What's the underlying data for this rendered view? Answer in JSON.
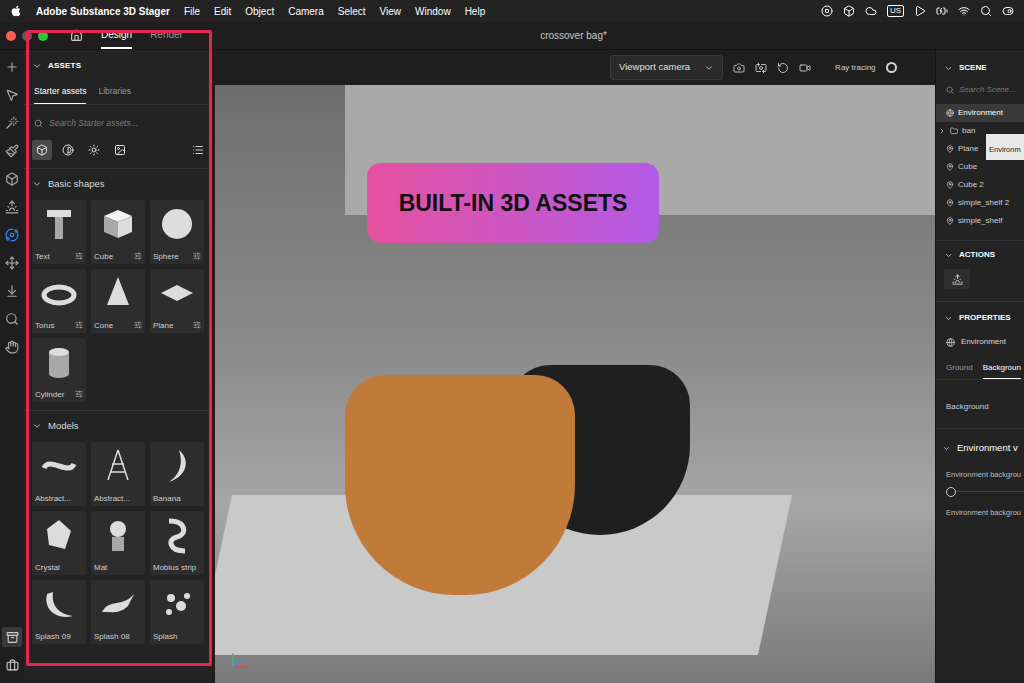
{
  "menubar": {
    "app": "Adobe Substance 3D Stager",
    "items": [
      "File",
      "Edit",
      "Object",
      "Camera",
      "Select",
      "View",
      "Window",
      "Help"
    ],
    "input_source": "US"
  },
  "titlebar": {
    "tabs": [
      {
        "label": "Design",
        "selected": true
      },
      {
        "label": "Render",
        "selected": false
      }
    ],
    "document": "crossover bag*"
  },
  "tools": [
    {
      "selected": false
    },
    {
      "selected": false
    },
    {
      "selected": false
    },
    {
      "selected": false
    },
    {
      "selected": false
    },
    {
      "selected": false
    },
    {
      "selected": true
    },
    {
      "selected": false
    },
    {
      "selected": false
    },
    {
      "selected": false
    },
    {
      "selected": false
    }
  ],
  "bottom_tools": [
    {
      "selected": true
    },
    {
      "selected": false
    }
  ],
  "assets": {
    "title": "ASSETS",
    "tabs": [
      {
        "label": "Starter assets",
        "selected": true
      },
      {
        "label": "Libraries",
        "selected": false
      }
    ],
    "search_placeholder": "Search Starter assets...",
    "filters": [
      {
        "selected": true
      },
      {
        "selected": false
      },
      {
        "selected": false
      },
      {
        "selected": false
      }
    ],
    "sections": [
      {
        "title": "Basic shapes",
        "expanded": true,
        "items": [
          {
            "label": "Text",
            "adjustable": true
          },
          {
            "label": "Cube",
            "adjustable": true
          },
          {
            "label": "Sphere",
            "adjustable": true
          },
          {
            "label": "Torus",
            "adjustable": true
          },
          {
            "label": "Cone",
            "adjustable": true
          },
          {
            "label": "Plane",
            "adjustable": true
          },
          {
            "label": "Cylinder",
            "adjustable": true
          }
        ]
      },
      {
        "title": "Models",
        "expanded": true,
        "items": [
          {
            "label": "Abstract...",
            "adjustable": false
          },
          {
            "label": "Abstract...",
            "adjustable": false
          },
          {
            "label": "Banana",
            "adjustable": false
          },
          {
            "label": "Crystal",
            "adjustable": false
          },
          {
            "label": "Mat",
            "adjustable": false
          },
          {
            "label": "Mobius strip",
            "adjustable": false
          },
          {
            "label": "Splash 09",
            "adjustable": false
          },
          {
            "label": "Splash 08",
            "adjustable": false
          },
          {
            "label": "Splash",
            "adjustable": false
          }
        ]
      }
    ]
  },
  "viewport": {
    "camera": "Viewport camera",
    "ray_tracing": {
      "label": "Ray tracing",
      "on": false
    },
    "overlay_label": "BUILT-IN 3D ASSETS"
  },
  "scene": {
    "title": "SCENE",
    "search_placeholder": "Search Scene...",
    "tooltip": "Environm",
    "items": [
      {
        "label": "Environment",
        "kind": "environment",
        "selected": true
      },
      {
        "label": "ban",
        "kind": "folder",
        "selected": false
      },
      {
        "label": "Plane",
        "kind": "object",
        "selected": false
      },
      {
        "label": "Cube",
        "kind": "object",
        "selected": false
      },
      {
        "label": "Cube 2",
        "kind": "object",
        "selected": false
      },
      {
        "label": "simple_shelf 2",
        "kind": "object",
        "selected": false
      },
      {
        "label": "simple_shelf",
        "kind": "object",
        "selected": false
      }
    ]
  },
  "actions": {
    "title": "ACTIONS"
  },
  "properties": {
    "title": "PROPERTIES",
    "object": "Environment",
    "tabs": [
      {
        "label": "Ground",
        "selected": false
      },
      {
        "label": "Backgroun",
        "selected": true
      }
    ],
    "field": "Background",
    "section": {
      "title": "Environment v",
      "expanded": true
    },
    "rows": [
      {
        "kind": "slider",
        "label": "Environment backgrou",
        "level": 0
      },
      {
        "kind": "label",
        "label": "Environment backgrou"
      }
    ]
  }
}
